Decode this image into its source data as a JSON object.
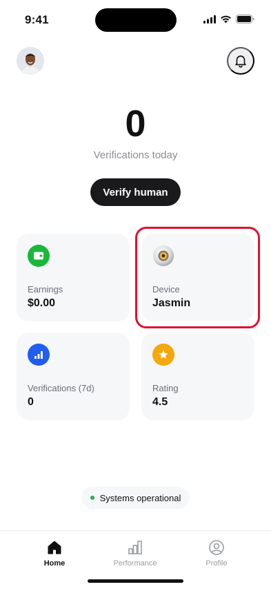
{
  "status_bar": {
    "time": "9:41"
  },
  "header": {
    "avatar_alt": "User avatar"
  },
  "hero": {
    "count": "0",
    "count_label": "Verifications today",
    "verify_button": "Verify human"
  },
  "cards": {
    "earnings": {
      "label": "Earnings",
      "value": "$0.00",
      "icon": "wallet-icon",
      "color": "#18b838"
    },
    "device": {
      "label": "Device",
      "value": "Jasmin",
      "icon": "orb-device-icon"
    },
    "verifications": {
      "label": "Verifications (7d)",
      "value": "0",
      "icon": "bar-chart-icon",
      "color": "#1f5ef0"
    },
    "rating": {
      "label": "Rating",
      "value": "4.5",
      "icon": "star-icon",
      "color": "#f5a80c"
    }
  },
  "system_status": {
    "text": "Systems operational",
    "color": "#22b14c"
  },
  "tabbar": {
    "tabs": [
      {
        "label": "Home",
        "active": true
      },
      {
        "label": "Performance",
        "active": false
      },
      {
        "label": "Profile",
        "active": false
      }
    ]
  },
  "highlight_color": "#e0122e"
}
